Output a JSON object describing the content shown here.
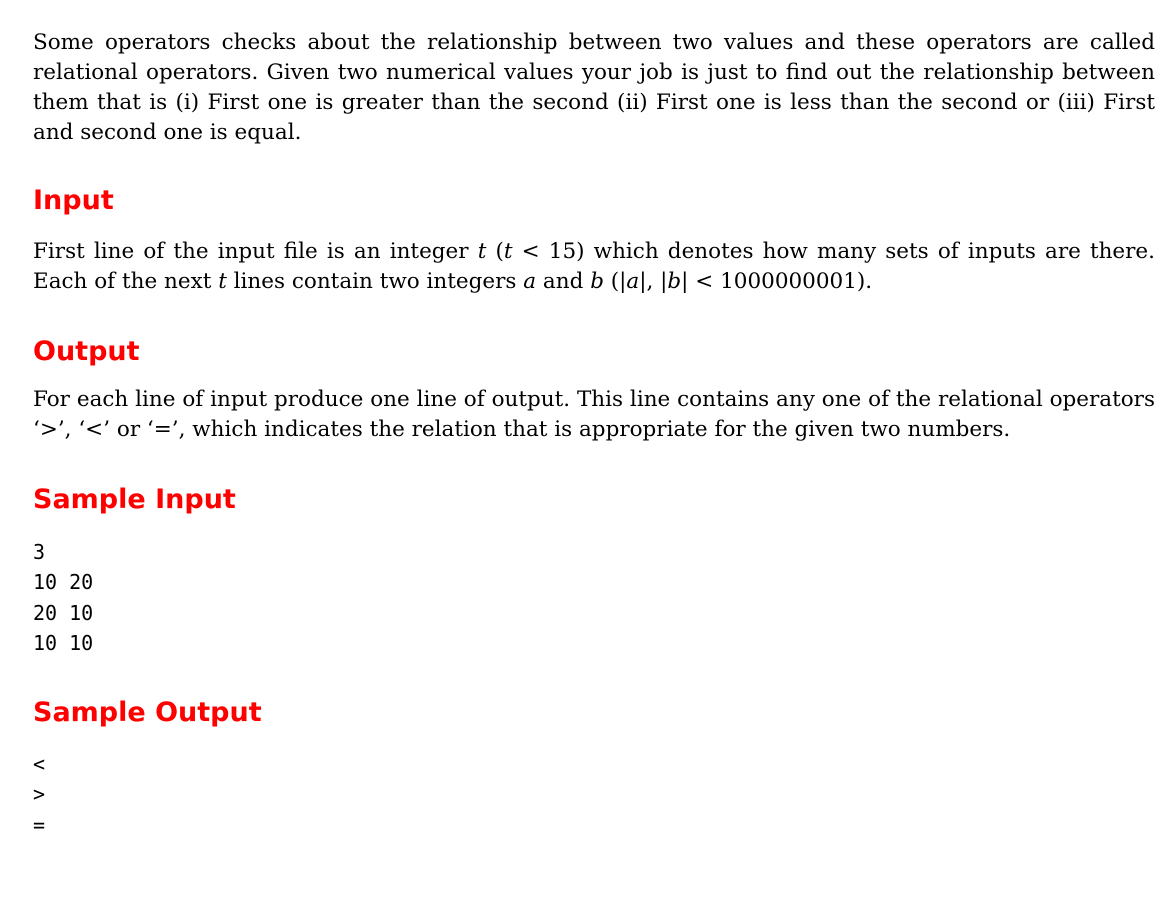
{
  "intro": {
    "text": "Some operators checks about the relationship between two values and these operators are called relational operators. Given two numerical values your job is just to find out the relationship between them that is (i) First one is greater than the second (ii) First one is less than the second or (iii) First and second one is equal."
  },
  "sections": {
    "input": {
      "heading": "Input",
      "part1": "First line of the input file is an integer ",
      "var_t": "t",
      "part2": " (",
      "part3": " < 15) which denotes how many sets of inputs are there. Each of the next ",
      "part4": " lines contain two integers ",
      "var_a": "a",
      "part5": " and ",
      "var_b": "b",
      "part6": " (|",
      "part7": "|, |",
      "part8": "| < 1000000001)."
    },
    "output": {
      "heading": "Output",
      "text": "For each line of input produce one line of output. This line contains any one of the relational operators ‘>’, ‘<’ or ‘=’, which indicates the relation that is appropriate for the given two numbers."
    },
    "sample_input": {
      "heading": "Sample Input",
      "lines": [
        "3",
        "10 20",
        "20 10",
        "10 10"
      ]
    },
    "sample_output": {
      "heading": "Sample Output",
      "lines": [
        "<",
        ">",
        "="
      ]
    }
  }
}
